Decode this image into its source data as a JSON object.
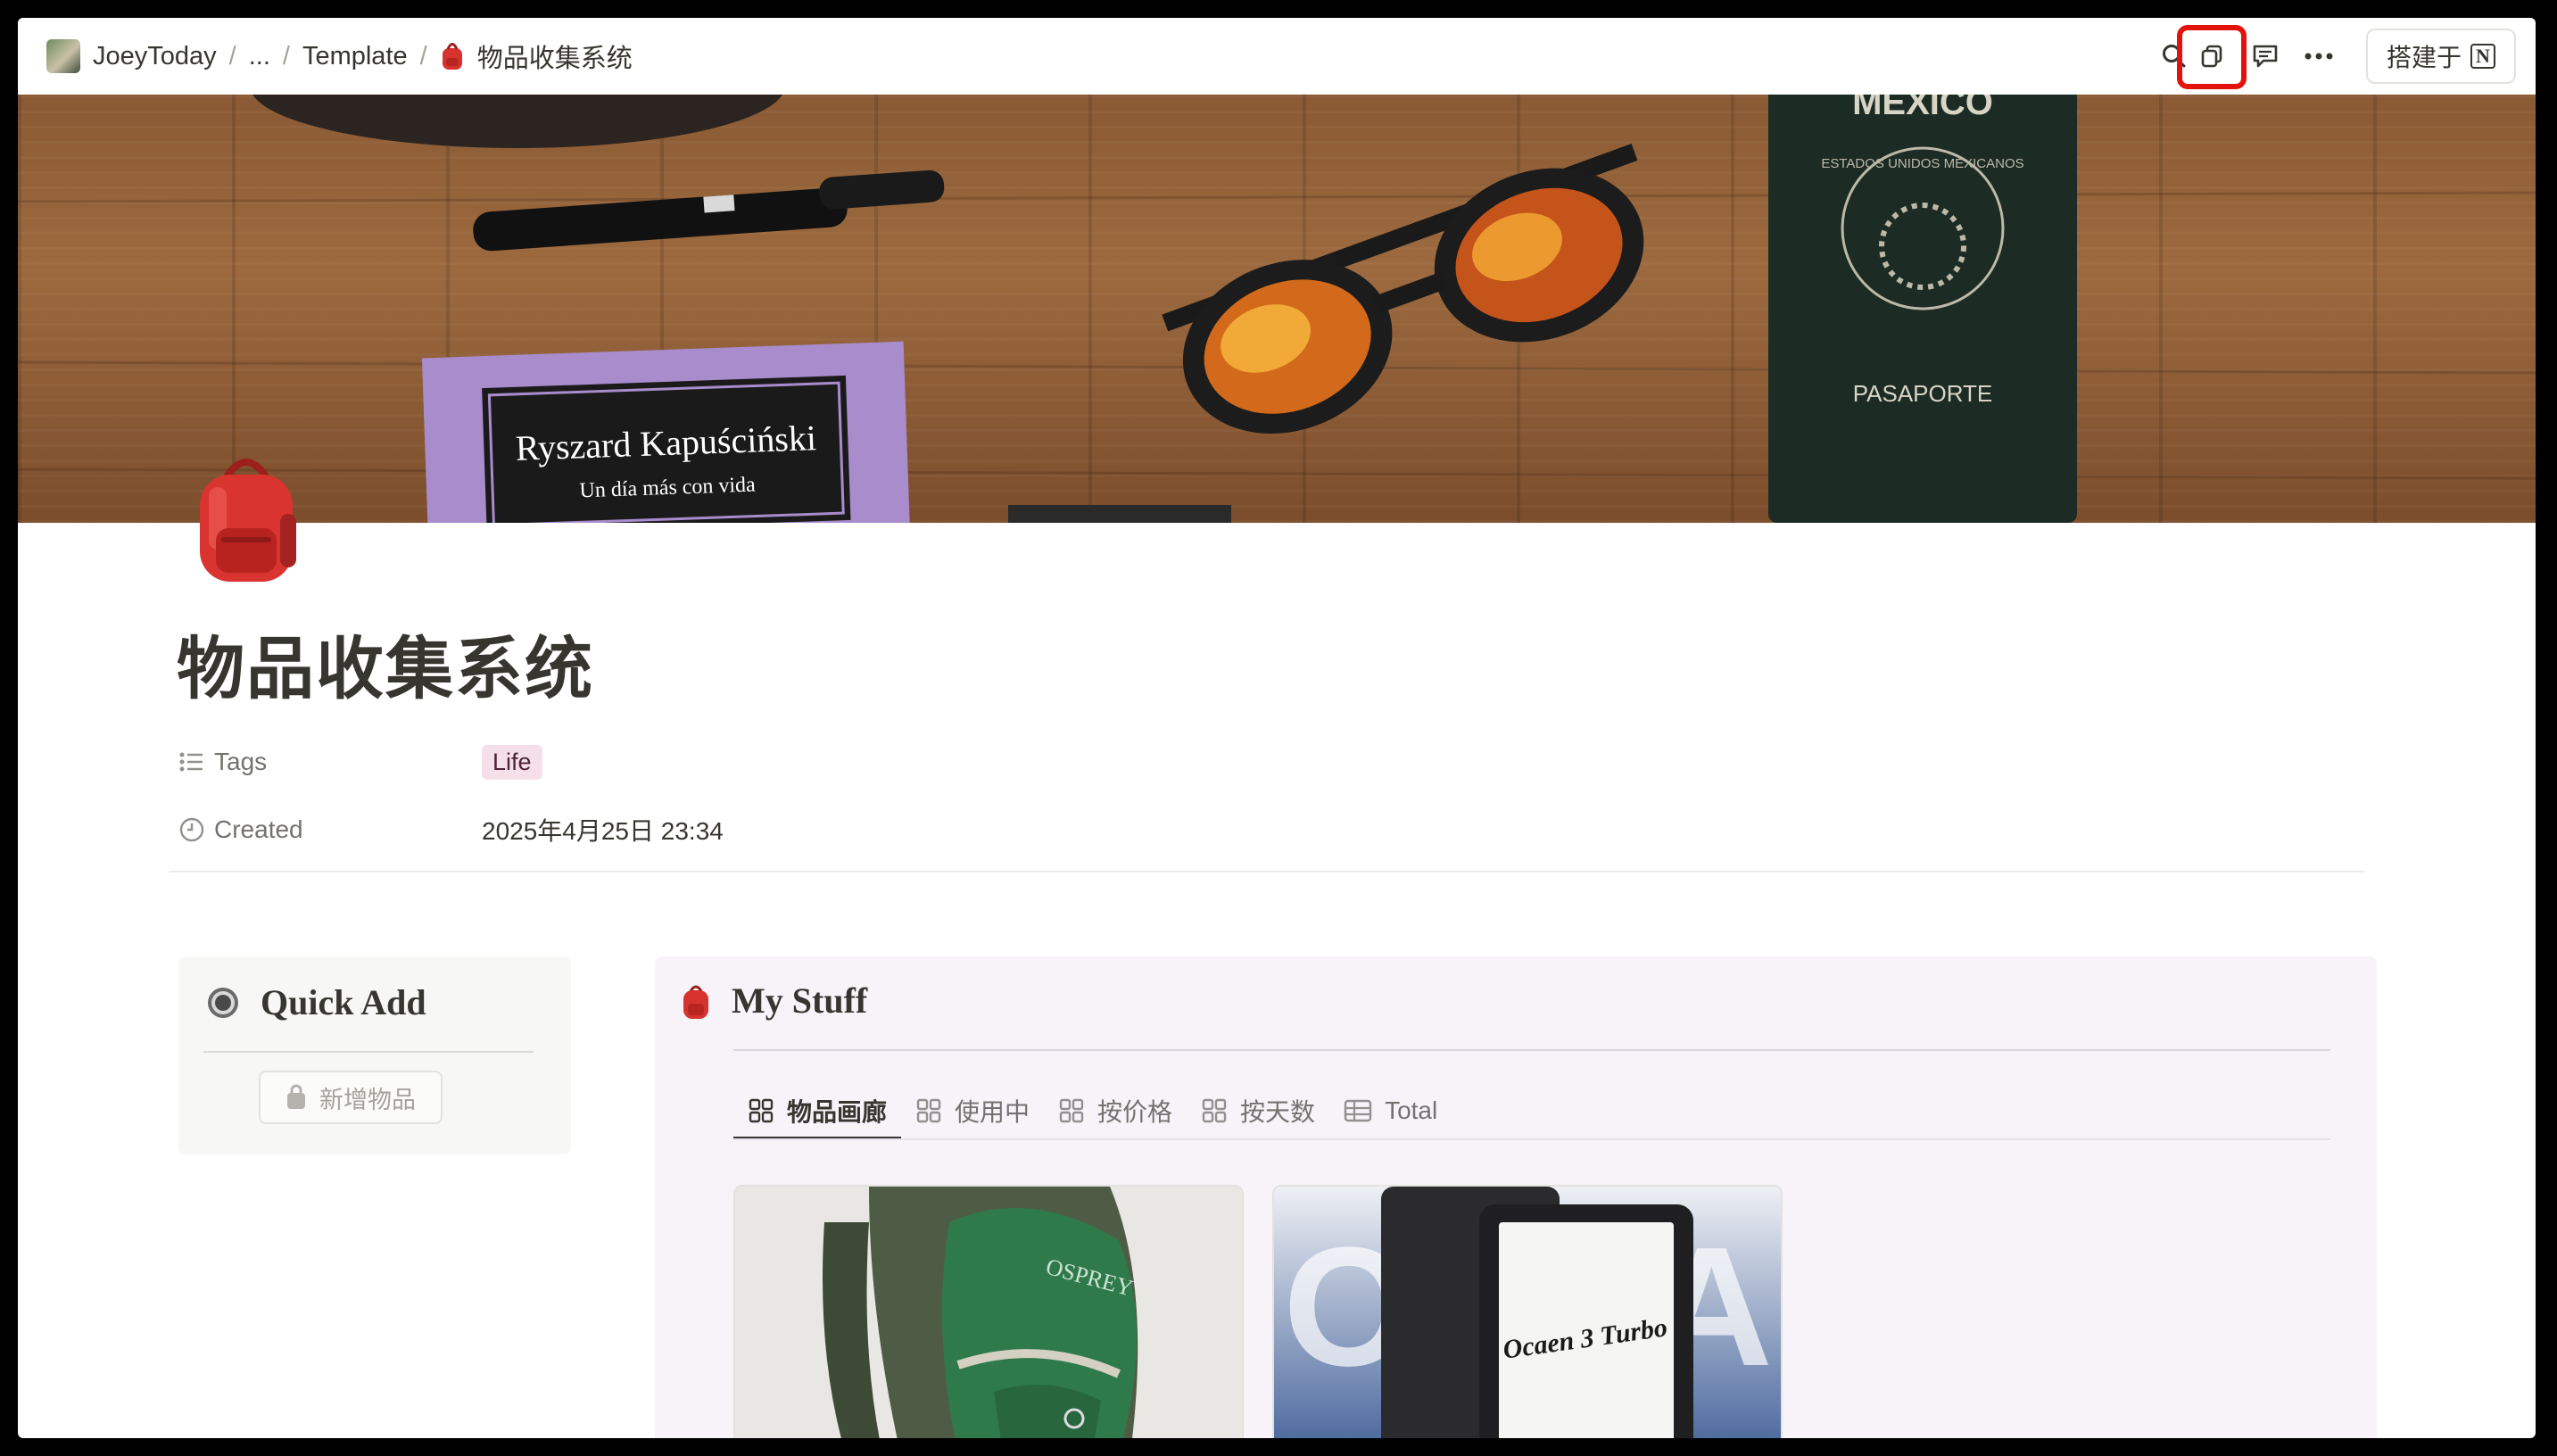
{
  "breadcrumb": {
    "workspace": "JoeyToday",
    "ellipsis": "...",
    "template": "Template",
    "page": "物品收集系统",
    "separator": "/"
  },
  "topbar": {
    "built_with_label": "搭建于",
    "notion_logo": "N",
    "highlight_color": "#e3120b"
  },
  "cover": {
    "book_author": "Ryszard Kapuściński",
    "book_title": "Un día más con vida",
    "passport_top": "MEXICO",
    "passport_seal": "ESTADOS UNIDOS MEXICANOS",
    "passport_label": "PASAPORTE"
  },
  "page": {
    "title": "物品收集系统",
    "properties": {
      "tags_label": "Tags",
      "tag_value": "Life",
      "created_label": "Created",
      "created_value": "2025年4月25日 23:34"
    }
  },
  "quick_add": {
    "title": "Quick Add",
    "button_label": "新增物品"
  },
  "my_stuff": {
    "title": "My Stuff",
    "tabs": [
      {
        "label": "物品画廊",
        "icon": "gallery-icon",
        "active": true
      },
      {
        "label": "使用中",
        "icon": "gallery-icon"
      },
      {
        "label": "按价格",
        "icon": "gallery-icon"
      },
      {
        "label": "按天数",
        "icon": "gallery-icon"
      },
      {
        "label": "Total",
        "icon": "table-icon"
      }
    ],
    "cards": [
      {
        "image_text": "OSPREY",
        "image": "green-backpack"
      },
      {
        "image_text": "Ocaen 3 Turbo",
        "image": "ereader"
      }
    ]
  }
}
